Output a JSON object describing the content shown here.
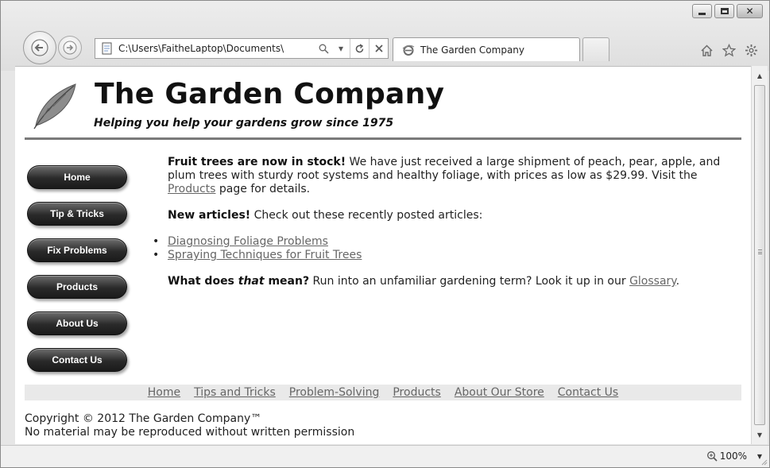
{
  "browser": {
    "address": "C:\\Users\\FaitheLaptop\\Documents\\",
    "tab_title": "The Garden Company",
    "zoom": "100%"
  },
  "site": {
    "title": "The Garden Company",
    "tagline": "Helping you help your gardens grow since 1975"
  },
  "sidenav": [
    {
      "label": "Home"
    },
    {
      "label": "Tip & Tricks"
    },
    {
      "label": "Fix Problems"
    },
    {
      "label": "Products"
    },
    {
      "label": "About Us"
    },
    {
      "label": "Contact Us"
    }
  ],
  "content": {
    "p1_bold": "Fruit trees are now in stock!",
    "p1_text": " We have just received a large shipment of peach, pear, apple, and plum trees with sturdy root systems and healthy foliage, with prices as low as $29.99. Visit the ",
    "p1_link": "Products",
    "p1_end": " page for details.",
    "p2_bold": "New articles!",
    "p2_text": " Check out these recently posted articles:",
    "articles": [
      "Diagnosing Foliage Problems",
      "Spraying Techniques for Fruit Trees"
    ],
    "p3_bold_a": "What does ",
    "p3_italic": "that",
    "p3_bold_b": " mean?",
    "p3_text": " Run into an unfamiliar gardening term? Look it up in our ",
    "p3_link": "Glossary",
    "p3_end": "."
  },
  "footer_nav": [
    "Home",
    "Tips and Tricks",
    "Problem-Solving",
    "Products",
    "About Our Store",
    "Contact Us"
  ],
  "copyright": {
    "line1": "Copyright © 2012 The Garden Company™",
    "line2": "No material may be reproduced without written permission"
  },
  "colors": {
    "link": "#666666",
    "rule": "#7a7a7a",
    "nav_button": "#2a2a2a"
  }
}
